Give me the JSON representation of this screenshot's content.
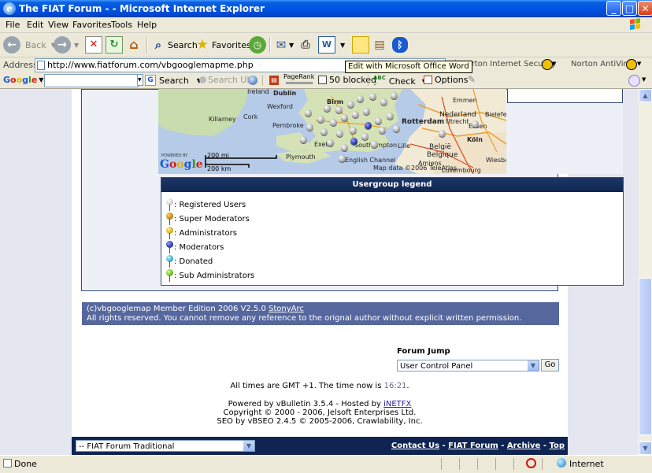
{
  "window": {
    "title": "The FIAT Forum - - Microsoft Internet Explorer"
  },
  "menu": [
    "File",
    "Edit",
    "View",
    "Favorites",
    "Tools",
    "Help"
  ],
  "toolbar": {
    "back": "Back",
    "search": "Search",
    "favorites": "Favorites"
  },
  "address": {
    "label": "Address",
    "url": "http://www.fiatforum.com/vbgooglemapme.php",
    "tooltip": "Edit with Microsoft Office Word"
  },
  "norton": {
    "security": "Norton Internet Security",
    "antivirus": "Norton AntiVirus"
  },
  "google_toolbar": {
    "search": "Search",
    "search_uk": "Search UK",
    "pagerank": "PageRank",
    "blocked": "50 blocked",
    "check": "Check",
    "options": "Options"
  },
  "map": {
    "labels": [
      "Ireland",
      "Dublin",
      "Wexford",
      "Killarney",
      "Cork",
      "Pembroke",
      "Birm",
      "Exeter",
      "Plymouth",
      "Southampton",
      "English Channel",
      "Rotterdam",
      "Nederland",
      "Emmen",
      "Bielefe",
      "Utrecht",
      "Essen",
      "Köln",
      "België",
      "Belgique",
      "Lille",
      "Amiens",
      "Wiesbaden",
      "Luxembourg"
    ],
    "powered_by": "POWERED BY",
    "google": "Google",
    "scale_mi": "200 mi",
    "scale_km": "200 km",
    "copyright": "Map data ©2006 TeleAtlas"
  },
  "legend": {
    "title": "Usergroup legend",
    "items": [
      {
        "label": ": Registered Users",
        "color": "#c8c8c8"
      },
      {
        "label": ": Super Moderators",
        "color": "#b07a10"
      },
      {
        "label": ": Administrators",
        "color": "#c9a400"
      },
      {
        "label": ": Moderators",
        "color": "#1b2a9a"
      },
      {
        "label": ": Donated",
        "color": "#2aa6c0"
      },
      {
        "label": ": Sub Administrators",
        "color": "#5cb000"
      }
    ]
  },
  "copyright_footer": {
    "line1_prefix": "(c)vbgooglemap Member Edition 2006 V2.5.0 ",
    "line1_link": "StonyArc",
    "line2": "All rights reserved. You cannot remove any reference to the orignal author without explicit written permission."
  },
  "forum_jump": {
    "label": "Forum Jump",
    "selected": "User Control Panel",
    "go": "Go"
  },
  "footer": {
    "times_prefix": "All times are GMT +1. The time now is ",
    "time": "16:21",
    "times_suffix": ".",
    "powered_prefix": "Powered by vBulletin 3.5.4 - Hosted by ",
    "host_link": "iNETFX",
    "copyright": "Copyright © 2000 - 2006, Jelsoft Enterprises Ltd.",
    "seo": "SEO by vBSEO 2.4.5 © 2005-2006, Crawlability, Inc."
  },
  "bottom": {
    "style_select": "-- FIAT Forum Traditional",
    "links": [
      "Contact Us",
      "FIAT Forum",
      "Archive",
      "Top"
    ],
    "separator": " - "
  },
  "status": {
    "text": "Done",
    "zone": "Internet"
  }
}
